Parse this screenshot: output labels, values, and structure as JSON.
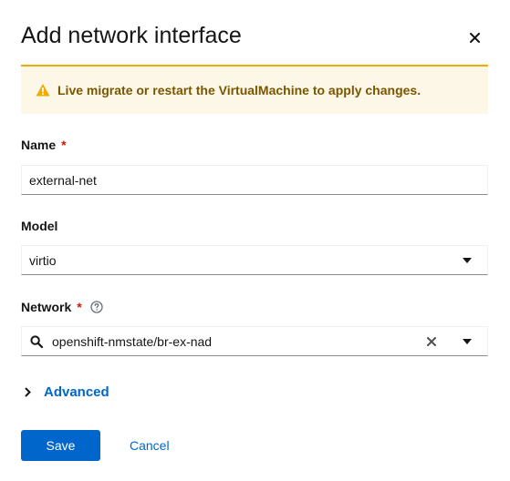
{
  "modal": {
    "title": "Add network interface",
    "close_icon": "close-icon"
  },
  "alert": {
    "icon": "warning-triangle-icon",
    "message": "Live migrate or restart the VirtualMachine to apply changes.",
    "accent_color": "#f0ab00"
  },
  "form": {
    "name": {
      "label": "Name",
      "required_marker": "*",
      "value": "external-net"
    },
    "model": {
      "label": "Model",
      "selected": "virtio",
      "caret_icon": "caret-down-icon"
    },
    "network": {
      "label": "Network",
      "required_marker": "*",
      "help_icon": "help-circle-icon",
      "search_icon": "search-icon",
      "value": "openshift-nmstate/br-ex-nad",
      "clear_icon": "clear-icon",
      "caret_icon": "caret-down-icon"
    },
    "advanced": {
      "label": "Advanced",
      "toggle_icon": "chevron-right-icon"
    }
  },
  "actions": {
    "save_label": "Save",
    "cancel_label": "Cancel",
    "primary_color": "#0066cc"
  }
}
